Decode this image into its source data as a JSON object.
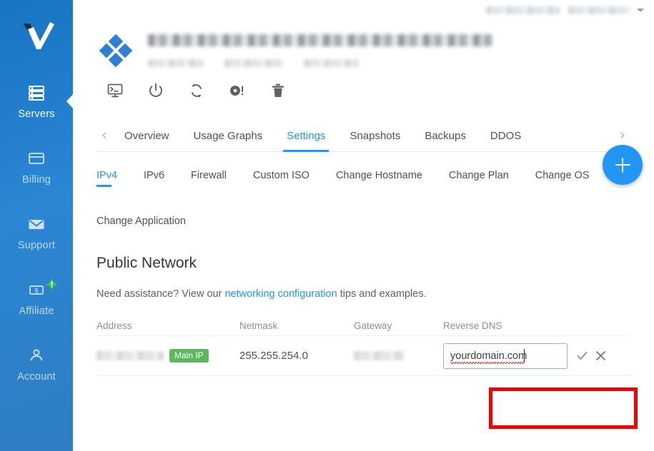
{
  "brand": {
    "logo_name": "vultr-checkmark-logo",
    "accent_blue": "#2196f3",
    "sidebar_blue": "#2b86d4",
    "badge_green": "#5cb85c",
    "annotation_red": "#f40000"
  },
  "sidebar": {
    "items": [
      {
        "label": "Servers",
        "icon": "server-stack-icon",
        "active": true,
        "badge": null
      },
      {
        "label": "Billing",
        "icon": "credit-card-icon",
        "active": false,
        "badge": null
      },
      {
        "label": "Support",
        "icon": "envelope-icon",
        "active": false,
        "badge": null
      },
      {
        "label": "Affiliate",
        "icon": "dollar-bill-icon",
        "active": false,
        "badge": "!"
      },
      {
        "label": "Account",
        "icon": "person-icon",
        "active": false,
        "badge": null
      }
    ]
  },
  "topbar": {
    "account_name_redacted": "",
    "account_email_redacted": "",
    "caret_icon": "chevron-down-icon"
  },
  "server": {
    "name_redacted": "",
    "meta_redacted": [
      "",
      "",
      ""
    ],
    "logo_icon": "server-diamond-logo",
    "actions": [
      {
        "name": "console-button",
        "icon": "console-monitor-icon"
      },
      {
        "name": "power-button",
        "icon": "power-icon"
      },
      {
        "name": "restart-button",
        "icon": "restart-arrows-icon"
      },
      {
        "name": "iso-button",
        "icon": "disc-alert-icon"
      },
      {
        "name": "destroy-button",
        "icon": "trash-icon"
      }
    ]
  },
  "tabs": {
    "prev_label": "‹",
    "next_label": "›",
    "items": [
      {
        "label": "Overview",
        "active": false
      },
      {
        "label": "Usage Graphs",
        "active": false
      },
      {
        "label": "Settings",
        "active": true
      },
      {
        "label": "Snapshots",
        "active": false
      },
      {
        "label": "Backups",
        "active": false
      },
      {
        "label": "DDOS",
        "active": false
      }
    ]
  },
  "subtabs": {
    "items": [
      {
        "label": "IPv4",
        "active": true
      },
      {
        "label": "IPv6",
        "active": false
      },
      {
        "label": "Firewall",
        "active": false
      },
      {
        "label": "Custom ISO",
        "active": false
      },
      {
        "label": "Change Hostname",
        "active": false
      },
      {
        "label": "Change Plan",
        "active": false
      },
      {
        "label": "Change OS",
        "active": false
      },
      {
        "label": "Change Application",
        "active": false
      }
    ]
  },
  "section": {
    "title": "Public Network",
    "assist_prefix": "Need assistance? View our ",
    "assist_link": "networking configuration",
    "assist_suffix": " tips and examples."
  },
  "table": {
    "headers": [
      "Address",
      "Netmask",
      "Gateway",
      "Reverse DNS"
    ],
    "rows": [
      {
        "address_redacted": "",
        "address_badge": "Main IP",
        "netmask": "255.255.254.0",
        "gateway_redacted": "",
        "reverse_dns_value": "yourdomain.com",
        "reverse_dns_placeholder": "yourdomain.com",
        "confirm_icon": "check-icon",
        "cancel_icon": "close-icon"
      }
    ]
  },
  "fab": {
    "name": "add-button",
    "icon": "plus-icon"
  }
}
